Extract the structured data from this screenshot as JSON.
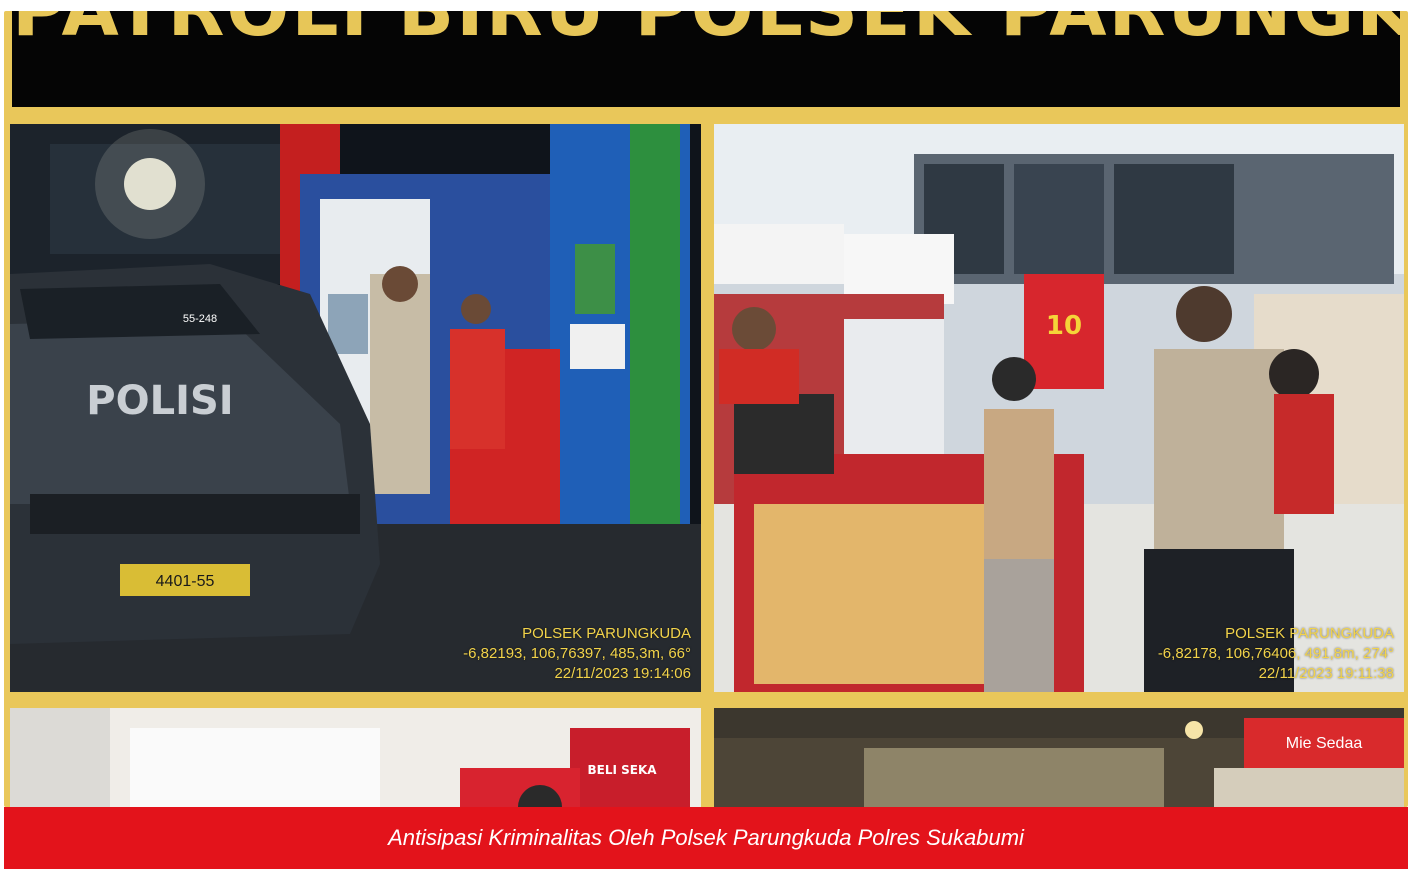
{
  "banner": {
    "title": "PATROLI BIRU POLSEK PARUNGKUDA"
  },
  "photos": [
    {
      "stamp_org": "POLSEK PARUNGKUDA",
      "stamp_coords": "-6,82193, 106,76397, 485,3m, 66°",
      "stamp_time": "22/11/2023 19:14:06",
      "car_text": "POLISI",
      "plate": "4401-55",
      "roof_code": "55-248"
    },
    {
      "stamp_org": "POLSEK PARUNGKUDA",
      "stamp_coords": "-6,82178, 106,76406, 491,8m, 274°",
      "stamp_time": "22/11/2023 19:11:38",
      "promo_number": "10"
    },
    {
      "sign_text": "BELI SEKA"
    },
    {
      "sign_text": "Mie Sedaa"
    }
  ],
  "caption": {
    "text": "Antisipasi Kriminalitas Oleh Polsek Parungkuda Polres Sukabumi"
  },
  "colors": {
    "frame": "#e9c75a",
    "banner": "#050505",
    "caption_bar": "#e3131b",
    "stamp": "#f2d34a"
  }
}
